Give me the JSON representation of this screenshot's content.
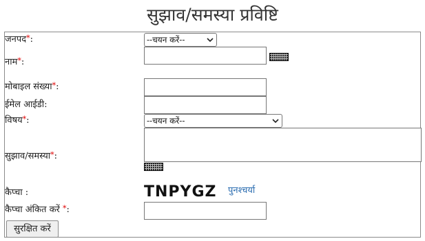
{
  "page": {
    "title": "सुझाव/समस्या प्रविष्टि"
  },
  "form": {
    "district": {
      "label": "जनपद",
      "required_mark": "*",
      "suffix": ":",
      "selected": "--चयन करें--"
    },
    "name": {
      "label": "नाम",
      "required_mark": "*",
      "suffix": ":",
      "value": ""
    },
    "mobile": {
      "label": "मोबाइल संख्या",
      "required_mark": "*",
      "suffix": ":",
      "value": ""
    },
    "email": {
      "label": "ईमेल आईडी:",
      "value": ""
    },
    "subject": {
      "label": "विषय",
      "required_mark": "*",
      "suffix": ":",
      "selected": "--चयन करें--"
    },
    "suggestion": {
      "label": "सुझाव/समस्या",
      "required_mark": "*",
      "suffix": ":",
      "value": ""
    },
    "captcha": {
      "label": "कैप्चा :",
      "code": "TNPYGZ",
      "refresh_label": "पुनश्चर्या"
    },
    "captcha_input": {
      "label": "कैप्चा अंकित करें ",
      "required_mark": "*",
      "suffix": ":",
      "value": ""
    },
    "submit_label": "सुरक्षित करें"
  },
  "icons": {
    "keyboard": "keyboard-icon",
    "dropdown": "chevron-down-icon"
  },
  "colors": {
    "required": "#e00000",
    "link": "#2a6cb0",
    "border": "#8a8a8a"
  }
}
